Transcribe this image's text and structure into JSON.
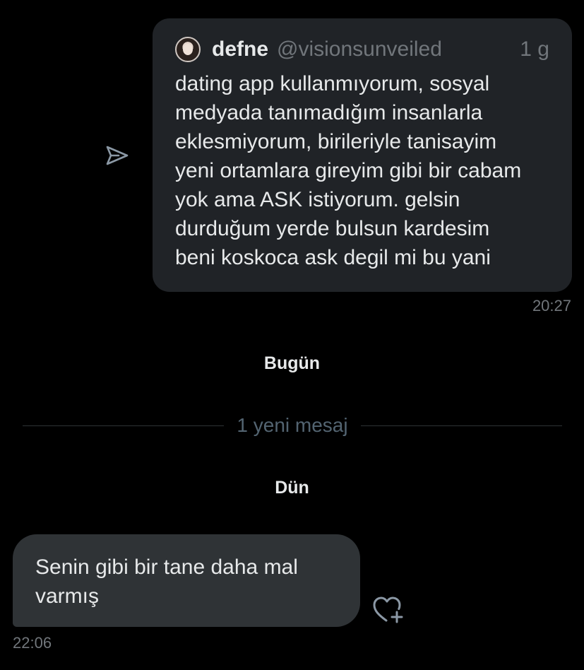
{
  "shared_tweet": {
    "name": "defne",
    "handle": "@visionsunveiled",
    "age": "1 g",
    "text": "dating app kullanmıyorum, sosyal\nmedyada tanımadığım insanlarla\neklesmiyorum, birileriyle tanisayim\nyeni ortamlara gireyim gibi bir cabam\nyok ama ASK istiyorum. gelsin\ndurduğum yerde bulsun kardesim\nbeni koskoca ask degil mi bu yani",
    "sent_time": "20:27"
  },
  "day_separators": {
    "today": "Bugün",
    "yesterday": "Dün"
  },
  "new_messages_divider": "1 yeni mesaj",
  "received_message": {
    "text": "Senin gibi bir tane daha mal\nvarmış",
    "time": "22:06"
  },
  "icons": {
    "share": "send-icon",
    "react": "heart-plus-icon",
    "avatar": "avatar"
  },
  "colors": {
    "background": "#000000",
    "card": "#202327",
    "bubble": "#2f3336",
    "secondary_text": "#71767b"
  }
}
